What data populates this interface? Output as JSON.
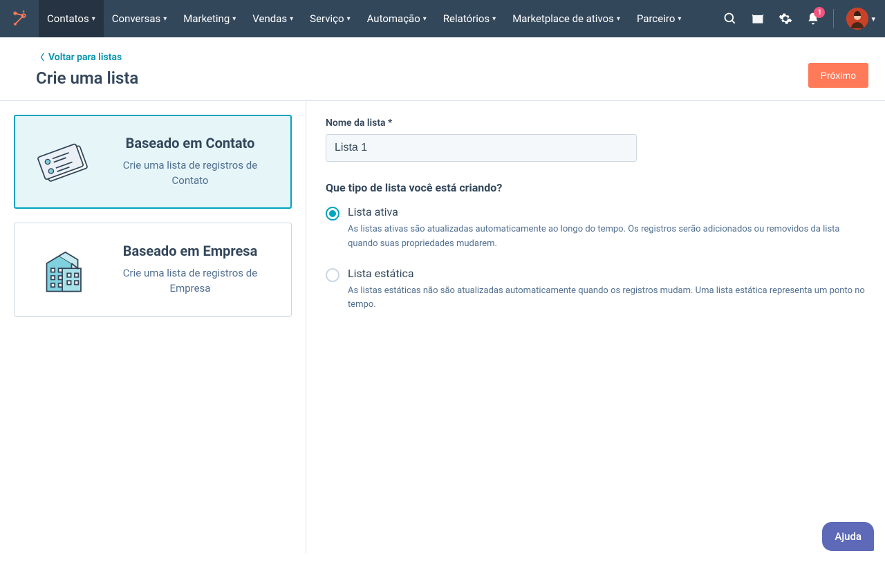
{
  "nav": {
    "items": [
      {
        "label": "Contatos",
        "active": true
      },
      {
        "label": "Conversas"
      },
      {
        "label": "Marketing"
      },
      {
        "label": "Vendas"
      },
      {
        "label": "Serviço"
      },
      {
        "label": "Automação"
      },
      {
        "label": "Relatórios"
      },
      {
        "label": "Marketplace de ativos"
      },
      {
        "label": "Parceiro"
      }
    ],
    "notif_count": "1"
  },
  "page": {
    "back_label": "Voltar para listas",
    "title": "Crie uma lista",
    "next_btn": "Próximo"
  },
  "cards": {
    "contact": {
      "title": "Baseado em Contato",
      "desc": "Crie uma lista de registros de Contato"
    },
    "company": {
      "title": "Baseado em Empresa",
      "desc": "Crie uma lista de registros de Empresa"
    }
  },
  "form": {
    "name_label": "Nome da lista *",
    "name_value": "Lista 1",
    "type_question": "Que tipo de lista você está criando?",
    "radio_active": {
      "label": "Lista ativa",
      "desc": "As listas ativas são atualizadas automaticamente ao longo do tempo. Os registros serão adicionados ou removidos da lista quando suas propriedades mudarem."
    },
    "radio_static": {
      "label": "Lista estática",
      "desc": "As listas estáticas não são atualizadas automaticamente quando os registros mudam. Uma lista estática representa um ponto no tempo."
    }
  },
  "help": {
    "label": "Ajuda"
  }
}
